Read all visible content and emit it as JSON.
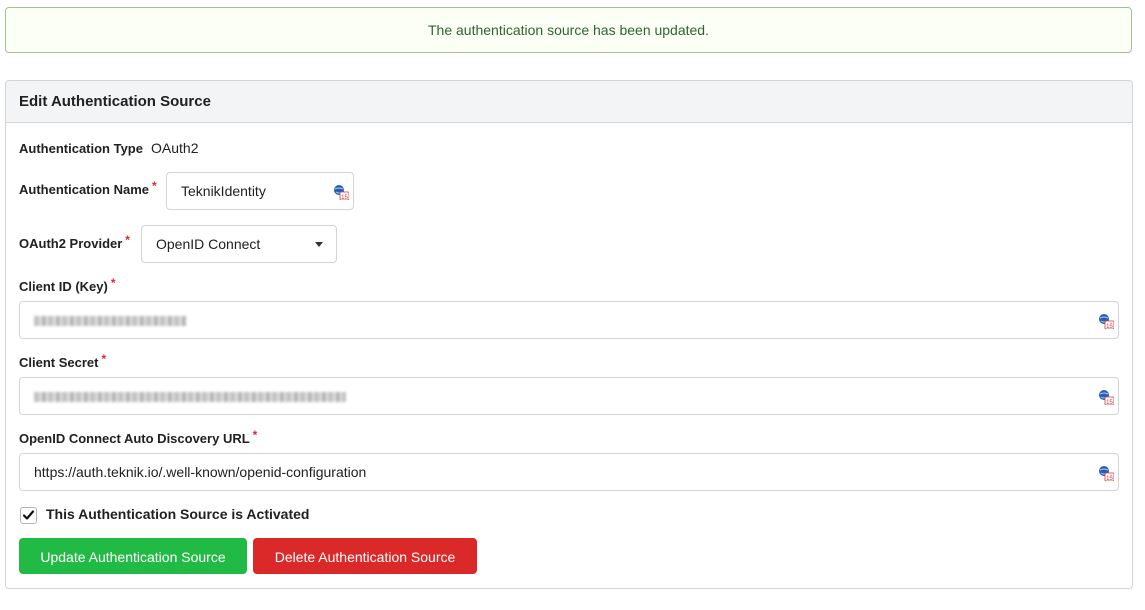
{
  "flash": {
    "message": "The authentication source has been updated."
  },
  "header": {
    "title": "Edit Authentication Source"
  },
  "form": {
    "auth_type": {
      "label": "Authentication Type",
      "value": "OAuth2"
    },
    "auth_name": {
      "label": "Authentication Name",
      "value": "TeknikIdentity"
    },
    "provider": {
      "label": "OAuth2 Provider",
      "value": "OpenID Connect"
    },
    "client_id": {
      "label": "Client ID (Key)"
    },
    "client_secret": {
      "label": "Client Secret"
    },
    "discovery_url": {
      "label": "OpenID Connect Auto Discovery URL",
      "value": "https://auth.teknik.io/.well-known/openid-configuration"
    },
    "required_marker": "*",
    "activated": {
      "label": "This Authentication Source is Activated",
      "checked": true
    }
  },
  "buttons": {
    "update": "Update Authentication Source",
    "delete": "Delete Authentication Source"
  },
  "colors": {
    "success_bg": "#fcfff5",
    "success_text": "#2c662d",
    "primary_green": "#21ba45",
    "danger_red": "#db2828",
    "required": "#db2828"
  },
  "icons": {
    "field_extension": "globe-badge-icon",
    "dropdown": "caret-down-icon",
    "check": "checkmark-icon"
  }
}
